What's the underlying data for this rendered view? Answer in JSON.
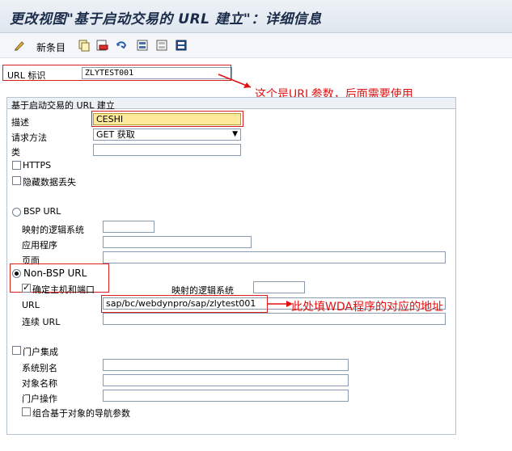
{
  "window": {
    "title": "更改视图\"基于启动交易的 URL 建立\"：详细信息"
  },
  "toolbar": {
    "new_entries_label": "新条目"
  },
  "url_id": {
    "label": "URL 标识",
    "value": "ZLYTEST001"
  },
  "annotations": {
    "url_param": "这个是URL参数，后面需要使用",
    "wda_url": "此处填WDA程序的对应的地址"
  },
  "group": {
    "title": "基于启动交易的 URL 建立",
    "description": {
      "label": "描述",
      "value": "CESHI"
    },
    "request_method": {
      "label": "请求方法",
      "value": "GET 获取"
    },
    "class": {
      "label": "类",
      "value": ""
    },
    "https_label": "HTTPS",
    "hide_data_loss_label": "隐藏数据丢失",
    "bsp": {
      "radio_label": "BSP URL",
      "mapped_logical_system_label": "映射的逻辑系统",
      "application_label": "应用程序",
      "page_label": "页面"
    },
    "non_bsp": {
      "radio_label": "Non-BSP  URL",
      "confirm_host_port_label": "确定主机和端口",
      "mapped_logical_system_label": "映射的逻辑系统",
      "url_label": "URL",
      "url_value": "sap/bc/webdynpro/sap/zlytest001",
      "continue_url_label": "连续 URL"
    },
    "portal": {
      "checkbox_label": "门户集成",
      "system_alias_label": "系统别名",
      "object_name_label": "对象名称",
      "portal_operation_label": "门户操作",
      "combine_nav_params_label": "组合基于对象的导航参数"
    }
  },
  "colors": {
    "annotation": "#e01010",
    "highlight_field": "#fde99a"
  }
}
